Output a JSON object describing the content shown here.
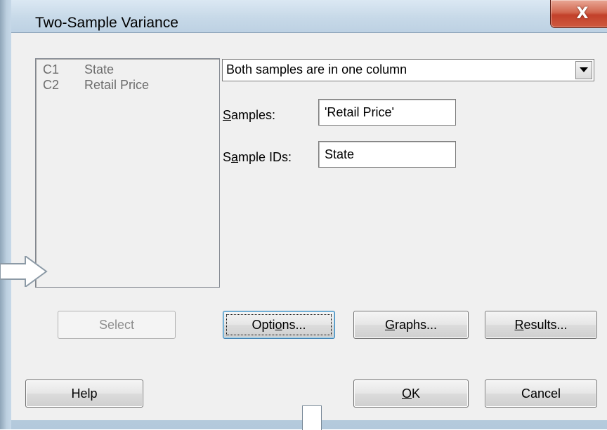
{
  "window": {
    "title": "Two-Sample Variance",
    "close_glyph": "X"
  },
  "variables": [
    {
      "col": "C1",
      "name": "State"
    },
    {
      "col": "C2",
      "name": "Retail Price"
    }
  ],
  "sample_layout": {
    "selected": "Both samples are in one column"
  },
  "fields": {
    "samples": {
      "label_pre": "",
      "label_u": "S",
      "label_post": "amples:",
      "value": "'Retail Price'"
    },
    "sample_ids": {
      "label_pre": "S",
      "label_u": "a",
      "label_post": "mple IDs:",
      "value": "State"
    }
  },
  "buttons": {
    "select": "Select",
    "options": {
      "pre": "Opti",
      "u": "o",
      "post": "ns..."
    },
    "graphs": {
      "pre": "",
      "u": "G",
      "post": "raphs..."
    },
    "results": {
      "pre": "",
      "u": "R",
      "post": "esults..."
    },
    "help": "Help",
    "ok": {
      "pre": "",
      "u": "O",
      "post": "K"
    },
    "cancel": "Cancel"
  },
  "icons": {
    "close": "close-icon",
    "dropdown": "chevron-down-icon",
    "pointer_arrow": "arrow-right-icon"
  }
}
